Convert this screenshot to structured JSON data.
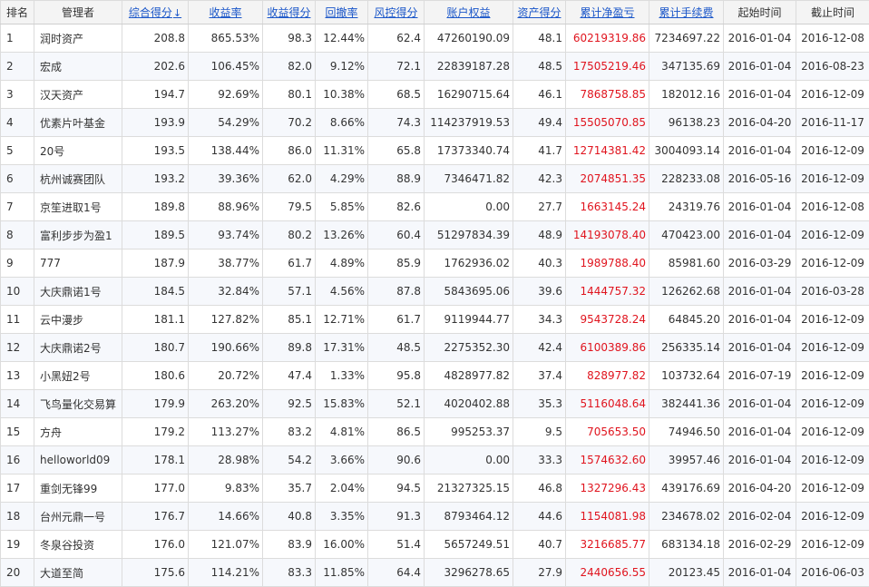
{
  "accent": {
    "link": "#1a56c9",
    "negative": "#e0141e",
    "sort_arrow": "#d40000"
  },
  "sort": {
    "arrow_icon": "↓"
  },
  "columns": [
    {
      "key": "rank",
      "label": "排名",
      "sortable": false
    },
    {
      "key": "manager",
      "label": "管理者",
      "sortable": false
    },
    {
      "key": "score",
      "label": "综合得分",
      "sortable": true,
      "sorted": true
    },
    {
      "key": "return",
      "label": "收益率",
      "sortable": true
    },
    {
      "key": "return_score",
      "label": "收益得分",
      "sortable": true
    },
    {
      "key": "drawdown",
      "label": "回撤率",
      "sortable": true
    },
    {
      "key": "risk_score",
      "label": "风控得分",
      "sortable": true
    },
    {
      "key": "equity",
      "label": "账户权益",
      "sortable": true
    },
    {
      "key": "asset_score",
      "label": "资产得分",
      "sortable": true
    },
    {
      "key": "cum_pnl",
      "label": "累计净盈亏",
      "sortable": true
    },
    {
      "key": "cum_fee",
      "label": "累计手续费",
      "sortable": true
    },
    {
      "key": "start",
      "label": "起始时间",
      "sortable": false
    },
    {
      "key": "end",
      "label": "截止时间",
      "sortable": false
    }
  ],
  "rows": [
    [
      "1",
      "润时资产",
      "208.8",
      "865.53%",
      "98.3",
      "12.44%",
      "62.4",
      "47260190.09",
      "48.1",
      "60219319.86",
      "7234697.22",
      "2016-01-04",
      "2016-12-08"
    ],
    [
      "2",
      "宏成",
      "202.6",
      "106.45%",
      "82.0",
      "9.12%",
      "72.1",
      "22839187.28",
      "48.5",
      "17505219.46",
      "347135.69",
      "2016-01-04",
      "2016-08-23"
    ],
    [
      "3",
      "汉天资产",
      "194.7",
      "92.69%",
      "80.1",
      "10.38%",
      "68.5",
      "16290715.64",
      "46.1",
      "7868758.85",
      "182012.16",
      "2016-01-04",
      "2016-12-09"
    ],
    [
      "4",
      "优素片叶基金",
      "193.9",
      "54.29%",
      "70.2",
      "8.66%",
      "74.3",
      "114237919.53",
      "49.4",
      "15505070.85",
      "96138.23",
      "2016-04-20",
      "2016-11-17"
    ],
    [
      "5",
      "20号",
      "193.5",
      "138.44%",
      "86.0",
      "11.31%",
      "65.8",
      "17373340.74",
      "41.7",
      "12714381.42",
      "3004093.14",
      "2016-01-04",
      "2016-12-09"
    ],
    [
      "6",
      "杭州诚赛团队",
      "193.2",
      "39.36%",
      "62.0",
      "4.29%",
      "88.9",
      "7346471.82",
      "42.3",
      "2074851.35",
      "228233.08",
      "2016-05-16",
      "2016-12-09"
    ],
    [
      "7",
      "京笙进取1号",
      "189.8",
      "88.96%",
      "79.5",
      "5.85%",
      "82.6",
      "0.00",
      "27.7",
      "1663145.24",
      "24319.76",
      "2016-01-04",
      "2016-12-08"
    ],
    [
      "8",
      "富利步步为盈1",
      "189.5",
      "93.74%",
      "80.2",
      "13.26%",
      "60.4",
      "51297834.39",
      "48.9",
      "14193078.40",
      "470423.00",
      "2016-01-04",
      "2016-12-09"
    ],
    [
      "9",
      "777",
      "187.9",
      "38.77%",
      "61.7",
      "4.89%",
      "85.9",
      "1762936.02",
      "40.3",
      "1989788.40",
      "85981.60",
      "2016-03-29",
      "2016-12-09"
    ],
    [
      "10",
      "大庆鼎诺1号",
      "184.5",
      "32.84%",
      "57.1",
      "4.56%",
      "87.8",
      "5843695.06",
      "39.6",
      "1444757.32",
      "126262.68",
      "2016-01-04",
      "2016-03-28"
    ],
    [
      "11",
      "云中漫步",
      "181.1",
      "127.82%",
      "85.1",
      "12.71%",
      "61.7",
      "9119944.77",
      "34.3",
      "9543728.24",
      "64845.20",
      "2016-01-04",
      "2016-12-09"
    ],
    [
      "12",
      "大庆鼎诺2号",
      "180.7",
      "190.66%",
      "89.8",
      "17.31%",
      "48.5",
      "2275352.30",
      "42.4",
      "6100389.86",
      "256335.14",
      "2016-01-04",
      "2016-12-09"
    ],
    [
      "13",
      "小黑妞2号",
      "180.6",
      "20.72%",
      "47.4",
      "1.33%",
      "95.8",
      "4828977.82",
      "37.4",
      "828977.82",
      "103732.64",
      "2016-07-19",
      "2016-12-09"
    ],
    [
      "14",
      "飞鸟量化交易算",
      "179.9",
      "263.20%",
      "92.5",
      "15.83%",
      "52.1",
      "4020402.88",
      "35.3",
      "5116048.64",
      "382441.36",
      "2016-01-04",
      "2016-12-09"
    ],
    [
      "15",
      "方舟",
      "179.2",
      "113.27%",
      "83.2",
      "4.81%",
      "86.5",
      "995253.37",
      "9.5",
      "705653.50",
      "74946.50",
      "2016-01-04",
      "2016-12-09"
    ],
    [
      "16",
      "helloworld09",
      "178.1",
      "28.98%",
      "54.2",
      "3.66%",
      "90.6",
      "0.00",
      "33.3",
      "1574632.60",
      "39957.46",
      "2016-01-04",
      "2016-12-09"
    ],
    [
      "17",
      "重剑无锋99",
      "177.0",
      "9.83%",
      "35.7",
      "2.04%",
      "94.5",
      "21327325.15",
      "46.8",
      "1327296.43",
      "439176.69",
      "2016-04-20",
      "2016-12-09"
    ],
    [
      "18",
      "台州元鼎一号",
      "176.7",
      "14.66%",
      "40.8",
      "3.35%",
      "91.3",
      "8793464.12",
      "44.6",
      "1154081.98",
      "234678.02",
      "2016-02-04",
      "2016-12-09"
    ],
    [
      "19",
      "冬泉谷投资",
      "176.0",
      "121.07%",
      "83.9",
      "16.00%",
      "51.4",
      "5657249.51",
      "40.7",
      "3216685.77",
      "683134.18",
      "2016-02-29",
      "2016-12-09"
    ],
    [
      "20",
      "大道至简",
      "175.6",
      "114.21%",
      "83.3",
      "11.85%",
      "64.4",
      "3296278.65",
      "27.9",
      "2440656.55",
      "20123.45",
      "2016-01-04",
      "2016-06-03"
    ]
  ]
}
